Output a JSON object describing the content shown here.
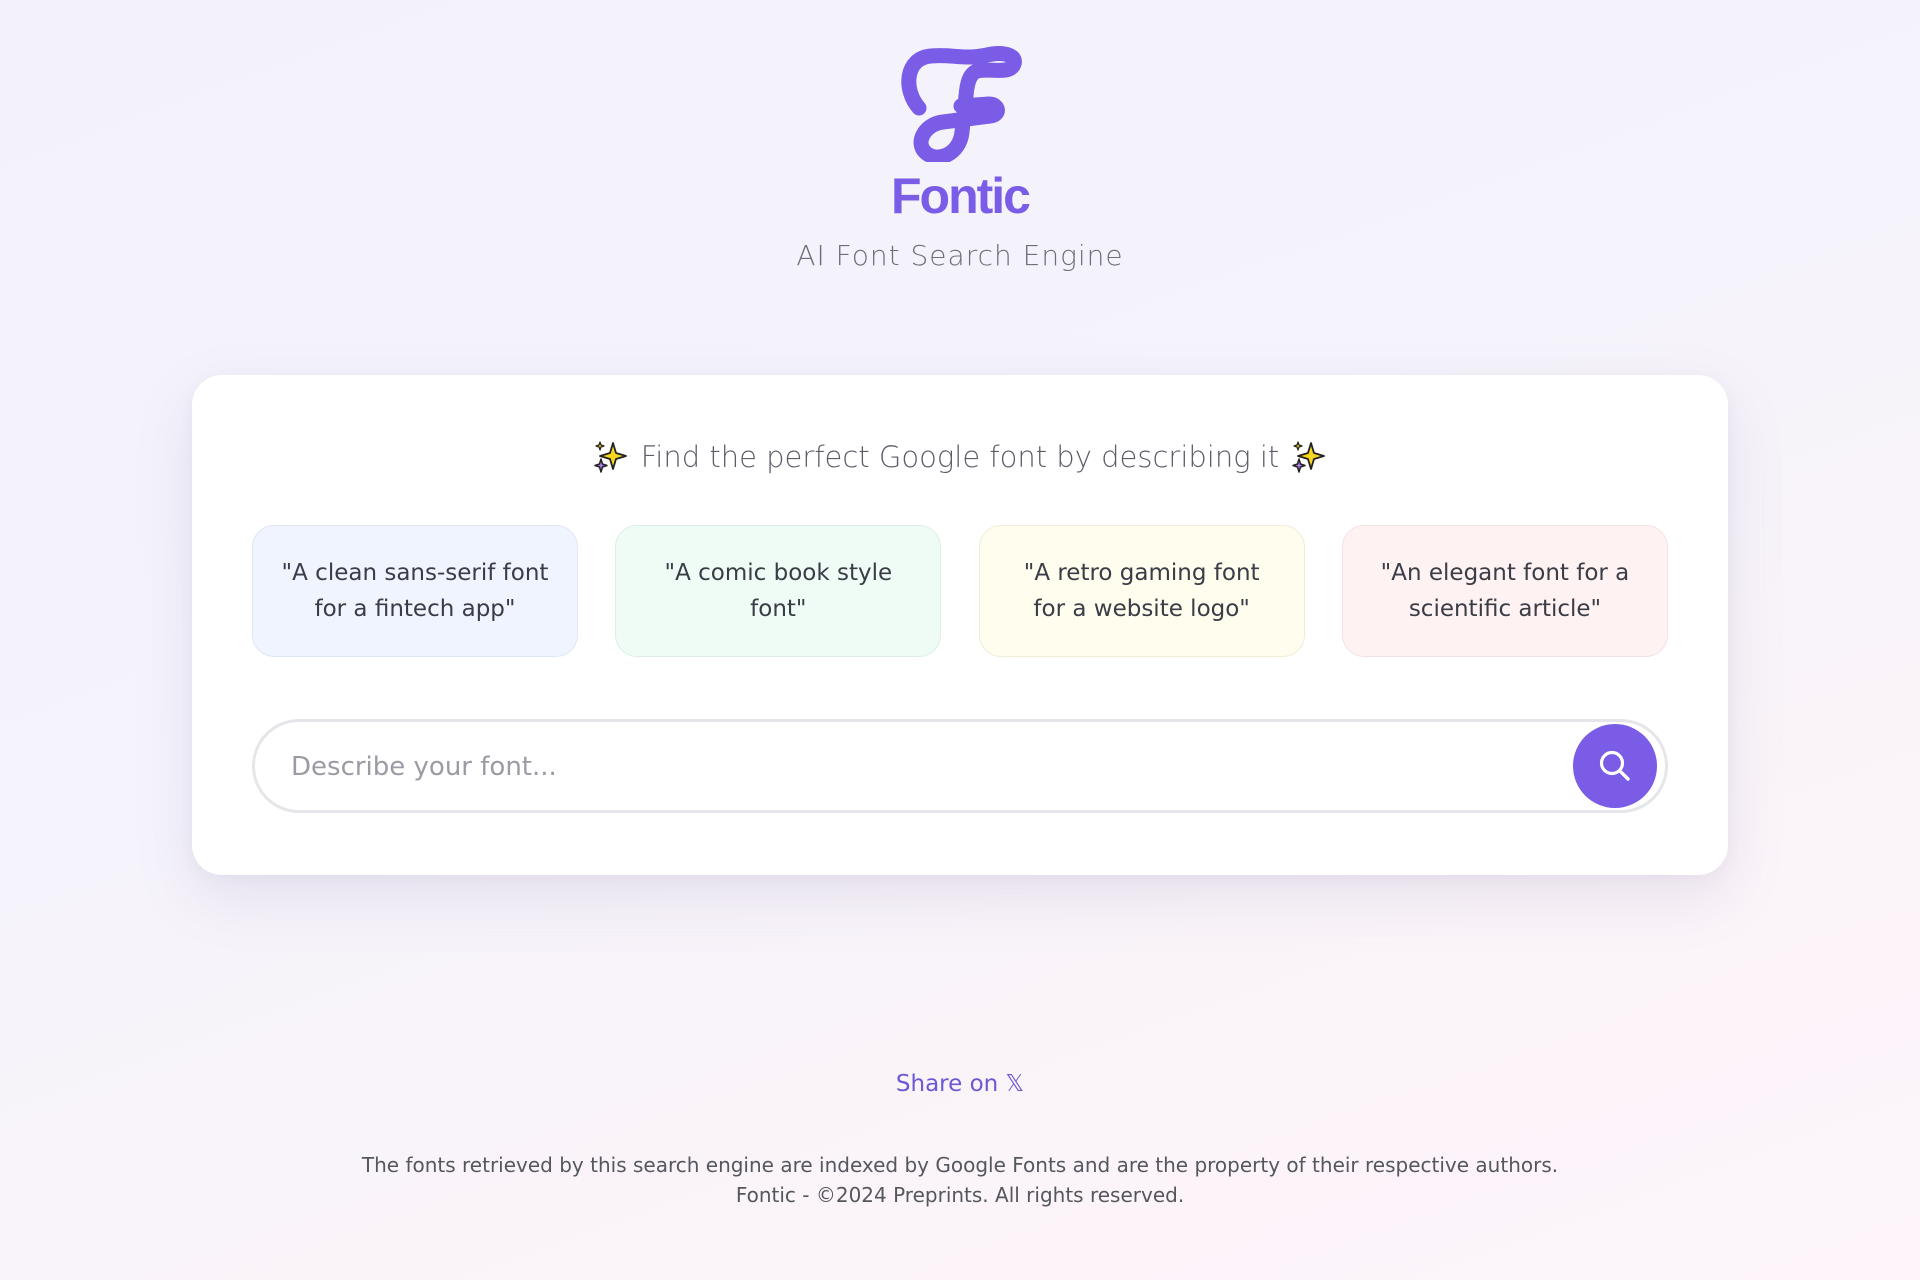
{
  "brand": {
    "name": "Fontic",
    "tagline": "AI Font Search Engine",
    "accent_color": "#7a5ce6"
  },
  "card": {
    "heading": "Find the perfect Google font by describing it",
    "heading_icon": "sparkles-icon",
    "examples": [
      {
        "text": "\"A clean sans-serif font for a fintech app\"",
        "color": "#f0f4ff"
      },
      {
        "text": "\"A comic book style font\"",
        "color": "#effcf5"
      },
      {
        "text": "\"A retro gaming font for a website logo\"",
        "color": "#fffdee"
      },
      {
        "text": "\"An elegant font for a scientific article\"",
        "color": "#fff2f3"
      }
    ]
  },
  "search": {
    "placeholder": "Describe your font...",
    "value": "",
    "button_icon": "search-icon"
  },
  "share": {
    "label": "Share on 𝕏"
  },
  "footer": {
    "line1": "The fonts retrieved by this search engine are indexed by Google Fonts and are the property of their respective authors.",
    "line2": "Fontic - ©2024 Preprints. All rights reserved."
  }
}
